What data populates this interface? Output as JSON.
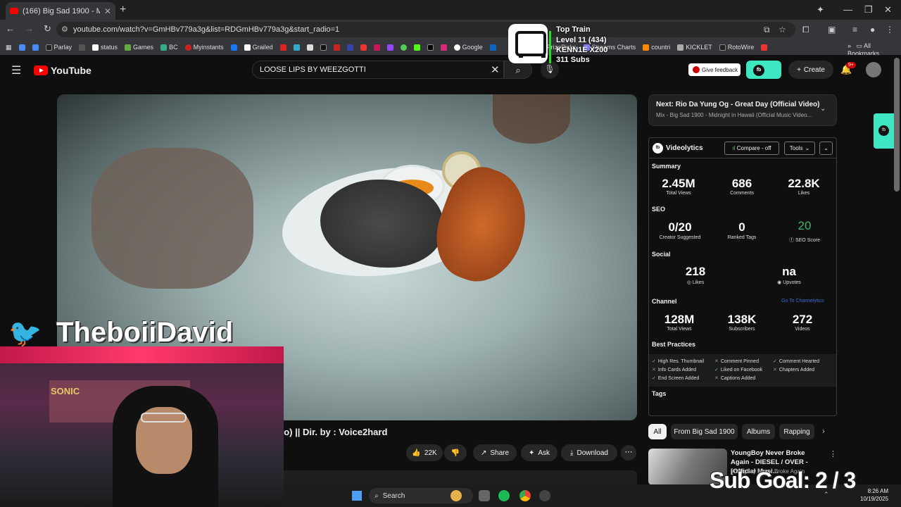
{
  "browser": {
    "tab_title": "(166) Big Sad 1900 - Midni...",
    "url": "youtube.com/watch?v=GmHBv779a3g&list=RDGmHBv779a3g&start_radio=1",
    "bookmarks": [
      "Parlay",
      "",
      "status",
      "Games",
      "BC",
      "Myinstants",
      "",
      "Grailed",
      "",
      "",
      "",
      "",
      "",
      "",
      "",
      "",
      "",
      "",
      "",
      "",
      "Google",
      ""
    ],
    "bookmark_tail": [
      "PrizePicks",
      "Streams Charts",
      "countri",
      "KICKLET",
      "RotoWire"
    ],
    "all_bookmarks": "All Bookmarks"
  },
  "youtube": {
    "logo_text": "YouTube",
    "search_query": "LOOSE LIPS BY WEEZGOTTI",
    "feedback": "Give feedback",
    "create": "Create",
    "notif_count": "9+"
  },
  "overlay_train": {
    "title": "Top Train",
    "level": "Level 11  (434)",
    "user": "KENN1E X200",
    "subs": "311 Subs"
  },
  "video": {
    "title_fragment": "eo) || Dir. by : Voice2hard",
    "likes": "22K",
    "share": "Share",
    "ask": "Ask",
    "download": "Download"
  },
  "up_next": {
    "title": "Next: Rio Da Yung Og - Great Day (Official Video)",
    "subtitle": "Mix - Big Sad 1900 - Midnight in Hawaii (Official Music Video..."
  },
  "videolytics": {
    "name": "Videolytics",
    "compare": "Compare - off",
    "tools": "Tools",
    "summary_label": "Summary",
    "summary": [
      {
        "value": "2.45M",
        "label": "Total Views"
      },
      {
        "value": "686",
        "label": "Comments"
      },
      {
        "value": "22.8K",
        "label": "Likes"
      }
    ],
    "seo_label": "SEO",
    "seo": [
      {
        "value": "0/20",
        "label": "Creator Suggested"
      },
      {
        "value": "0",
        "label": "Ranked Tags"
      },
      {
        "value": "20",
        "label": "SEO Score"
      }
    ],
    "social_label": "Social",
    "social": [
      {
        "value": "218",
        "label": "Likes"
      },
      {
        "value": "na",
        "label": "Upvotes"
      }
    ],
    "channel_label": "Channel",
    "go_to": "Go To Channelytics",
    "channel": [
      {
        "value": "128M",
        "label": "Total Views"
      },
      {
        "value": "138K",
        "label": "Subscribers"
      },
      {
        "value": "272",
        "label": "Videos"
      }
    ],
    "best_practices_label": "Best Practices",
    "best_practices": [
      {
        "text": "High Res. Thumbnail",
        "ok": true
      },
      {
        "text": "Comment Pinned",
        "ok": false
      },
      {
        "text": "Comment Hearted",
        "ok": true
      },
      {
        "text": "Info Cards Added",
        "ok": false
      },
      {
        "text": "Liked on Facebook",
        "ok": true
      },
      {
        "text": "Chapters Added",
        "ok": false
      },
      {
        "text": "End Screen Added",
        "ok": true
      },
      {
        "text": "Captions Added",
        "ok": false
      }
    ],
    "tags_label": "Tags"
  },
  "chips": [
    "All",
    "From Big Sad 1900",
    "Albums",
    "Rapping"
  ],
  "recommended": {
    "title": "YoungBoy Never Broke Again - DIESEL / OVER - [Official Musi...",
    "channel": "YoungBoy Never Broke Again"
  },
  "stream": {
    "handle": "TheboiiDavid",
    "sub_goal": "Sub Goal:  2 / 3",
    "cam_sign": "SONIC"
  },
  "taskbar": {
    "search": "Search",
    "time": "8:26 AM",
    "date": "10/19/2025"
  },
  "colors": {
    "youtube_red": "#ff0000",
    "feedbackbuddy": "#3ee6c2",
    "twitter": "#1d9bf0",
    "train_bar": "#22dd22"
  }
}
